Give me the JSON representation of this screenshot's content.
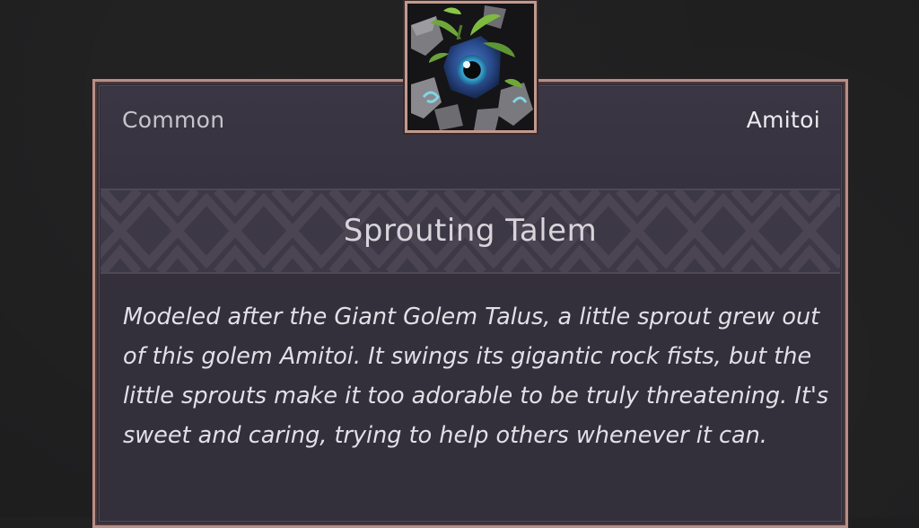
{
  "item": {
    "rarity": "Common",
    "category": "Amitoi",
    "name": "Sprouting Talem",
    "description": "Modeled after the Giant Golem Talus, a little sprout grew out of this golem Amitoi. It swings its gigantic rock fists, but the little sprouts make it too adorable to be truly threatening. It's sweet and caring, trying to help others whenever it can.",
    "portrait_icon": "golem-sprout-icon"
  },
  "colors": {
    "background": "#1e1e1f",
    "panel": "#332f3b",
    "frame": "#b88e86",
    "text": "#e2e0e6",
    "rarity_text": "#c7c4cc"
  }
}
